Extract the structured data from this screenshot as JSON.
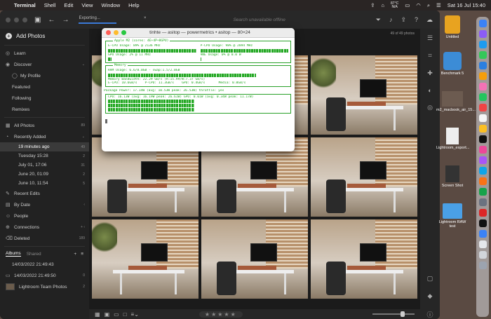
{
  "menubar": {
    "app": "Terminal",
    "items": [
      "Shell",
      "Edit",
      "View",
      "Window",
      "Help"
    ],
    "battery_top": "87°C",
    "battery_bottom": "N/A",
    "clock": "Sat 16 Jul  15:40"
  },
  "lightroom": {
    "exporting_label": "Exporting...",
    "search_placeholder": "Search unavailable offline",
    "photo_count": "49 of 49 photos",
    "sidebar": {
      "add_photos": "Add Photos",
      "learn": "Learn",
      "discover": "Discover",
      "my_profile": "My Profile",
      "featured": "Featured",
      "following": "Following",
      "remixes": "Remixes",
      "all_photos": "All Photos",
      "all_photos_count": "89",
      "recently_added": "Recently Added",
      "recent_dates": [
        {
          "label": "19 minutes ago",
          "count": "49"
        },
        {
          "label": "Tuesday  15:28",
          "count": "2"
        },
        {
          "label": "July 01, 17:06",
          "count": "31"
        },
        {
          "label": "June 20, 01:09",
          "count": "2"
        },
        {
          "label": "June 10, 11:54",
          "count": "5"
        }
      ],
      "recent_edits": "Recent Edits",
      "by_date": "By Date",
      "people": "People",
      "connections": "Connections",
      "deleted": "Deleted",
      "deleted_count": "189",
      "tab_albums": "Albums",
      "tab_shared": "Shared",
      "albums": [
        {
          "label": "14/03/2022 21:49:43",
          "count": ""
        },
        {
          "label": "14/03/2022 21:49:50",
          "count": "0"
        },
        {
          "label": "Lightroom Team Photos",
          "count": "2"
        }
      ]
    },
    "stars": "★★★★★"
  },
  "terminal": {
    "title": "tinhte — asitop — powermetrics • asitop — 80×24",
    "header_line": "Apple M2 (cores: 4E+4P+8GPU)",
    "ecpu": "E-CPU Usage: 89% @ 2136 MHz",
    "pcpu": "P-CPU Usage: 98% @ 2894 MHz",
    "gpu": "GPU Usage: 2% @ 11 MHz",
    "ane": "ANE Usage: 0% @ 0.0 W",
    "memory_label": "Memory",
    "ram": "RAM Usage: 6.6/8.0GB - swap:1.5/2.0GB",
    "bandwidth": "Memory Bandwidth: 22.29 GB/s (R:15.99/W:7.37 GB/s)",
    "bw_detail": "E-CPU: 10.6GB/s    P-CPU: 11.3GB/s    GPU: 0.4GB/s       Media: 0.0GB/s",
    "package": "Package Power: 17.14W (avg: 10.53W peak: 26.53W) throttle: yes",
    "cpu_power": "CPU: 16.13W (avg: 16.19W peak: 26.61W) GPU: 0.01W (avg: 0.34W peak: 11.17W)"
  },
  "desktop": {
    "files": [
      "Untitled",
      "Benchmark 5",
      "m2_macbook_air_15...",
      "Lightroom_export...",
      "Screen Shot",
      "Lightroom RAW test"
    ]
  }
}
